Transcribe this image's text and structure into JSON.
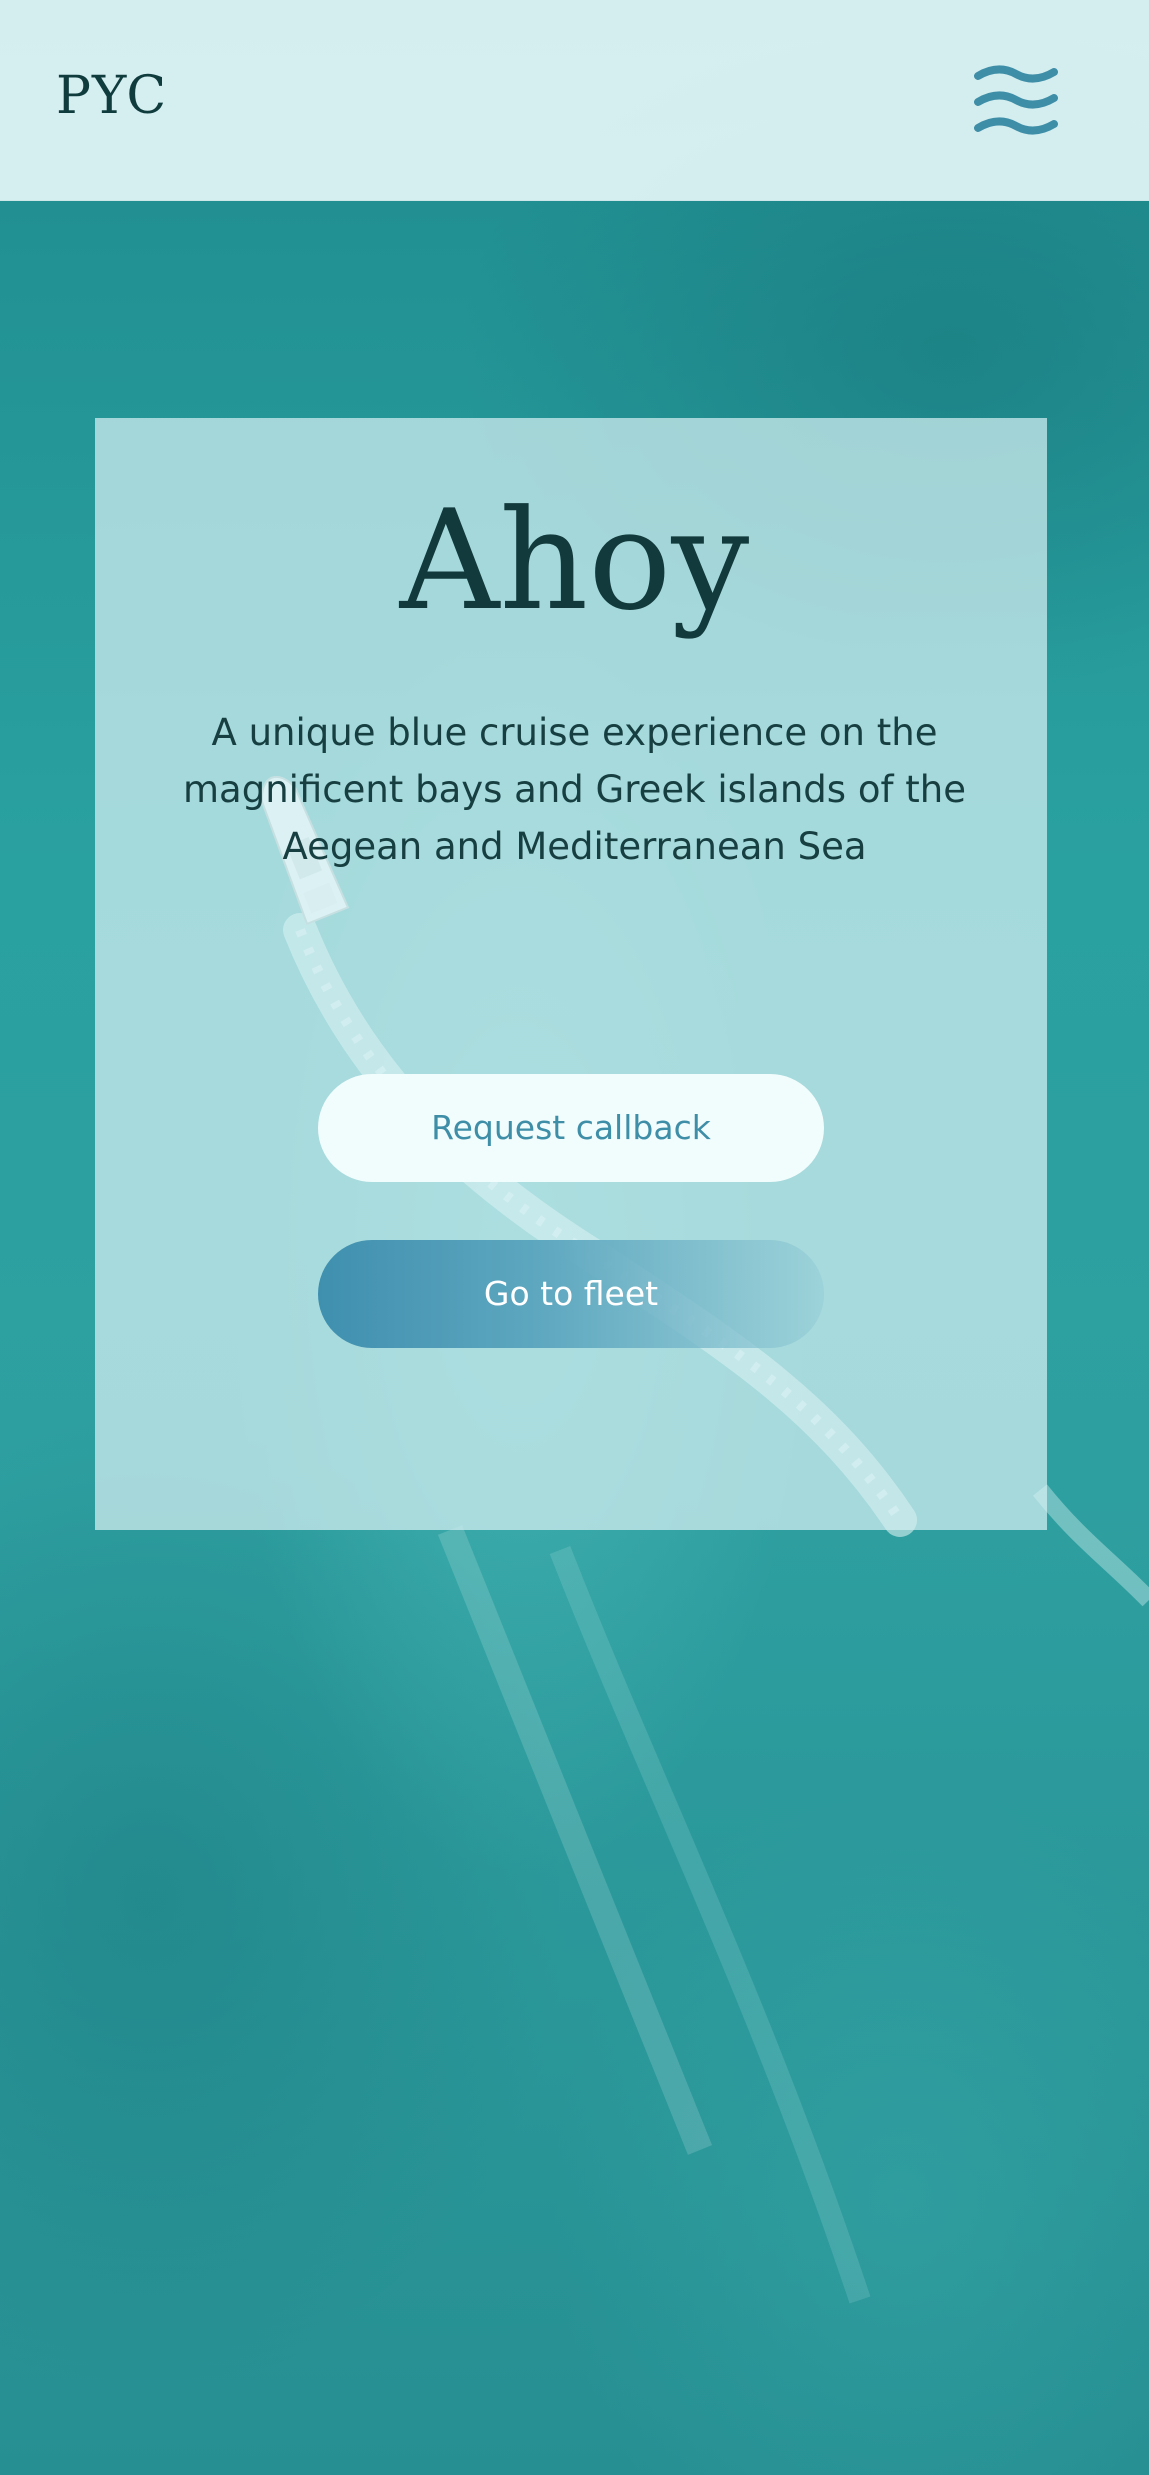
{
  "header": {
    "logo_text": "PYC",
    "menu_icon": "wave-menu-icon"
  },
  "hero": {
    "title": "Ahoy",
    "subtitle": "A unique blue cruise experience on the magnificent bays and Greek islands of the Aegean and Mediterranean Sea",
    "request_callback_label": "Request callback",
    "go_to_fleet_label": "Go to fleet"
  },
  "colors": {
    "accent": "#3f8ea8",
    "header_bg": "#e0f4f5",
    "text_dark": "#123a3c",
    "sea": "#2a9c9d"
  }
}
